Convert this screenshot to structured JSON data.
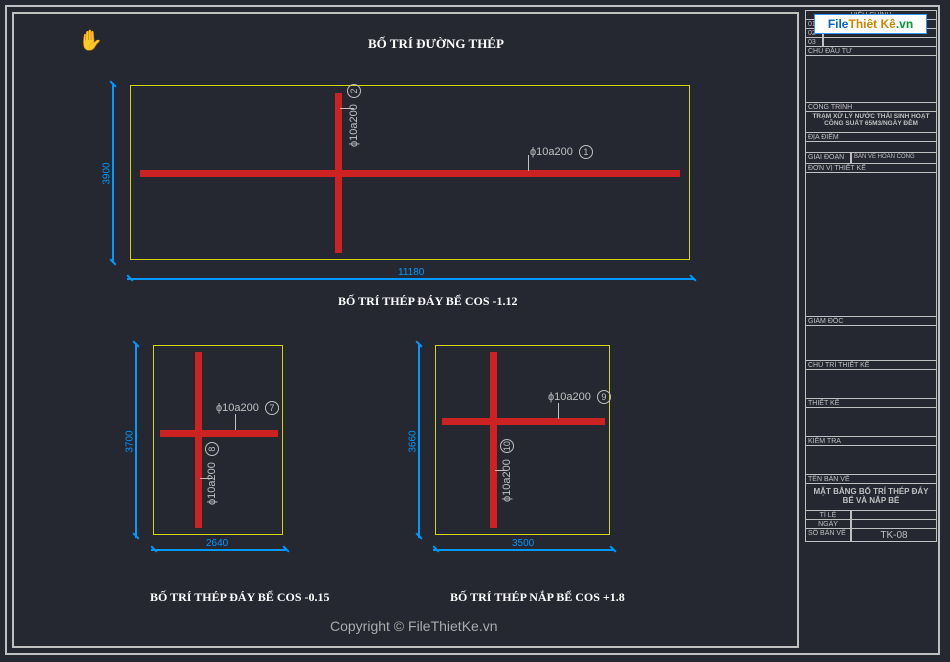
{
  "titles": {
    "main": "BỐ TRÍ ĐƯỜNG THÉP",
    "sub1": "BỐ TRÍ THÉP ĐÁY BỂ COS -1.12",
    "sub2": "BỐ TRÍ THÉP ĐÁY BỂ COS -0.15",
    "sub3": "BỐ TRÍ THÉP NẮP BỂ COS +1.8"
  },
  "dimensions": {
    "top_width": "11180",
    "top_height": "3900",
    "left_width": "2640",
    "left_height": "3700",
    "right_width": "3500",
    "right_height": "3660"
  },
  "rebar": {
    "label_1": "ϕ10a200",
    "tag_1": "1",
    "label_2": "ϕ10a200",
    "tag_2": "2",
    "label_7": "ϕ10a200",
    "tag_7": "7",
    "label_8": "ϕ10a200",
    "tag_8": "8",
    "label_9": "ϕ10a200",
    "tag_9": "9",
    "label_10": "ϕ10a200",
    "tag_10": "10"
  },
  "titleblock": {
    "hieu_chinh": "HIỆU CHỈNH",
    "r1": "01",
    "r2": "02",
    "r3": "03",
    "chu_dau_tu": "CHỦ ĐẦU TƯ",
    "cong_trinh": "CÔNG TRÌNH",
    "cong_trinh_val": "TRẠM XỬ LÝ NƯỚC THẢI SINH HOẠT CÔNG SUẤT 65M3/NGÀY ĐÊM",
    "dia_diem": "ĐỊA ĐIỂM",
    "giai_doan": "GIAI ĐOẠN",
    "ban_ve": "BẢN VẼ HOÀN CÔNG",
    "don_vi": "ĐƠN VỊ THIẾT KẾ",
    "giam_doc": "GIÁM ĐỐC",
    "chu_tri": "CHỦ TRÌ THIẾT KẾ",
    "thiet_ke": "THIẾT KẾ",
    "kiem_tra": "KIỂM TRA",
    "ten_ban_ve": "TÊN BẢN VẼ",
    "ten_ban_ve_val": "MẶT BẰNG BỐ TRÍ THÉP ĐÁY BỂ VÀ NẮP BỂ",
    "ti_le": "TỈ LỆ",
    "ngay": "NGÀY",
    "so_ban_ve": "SỐ BẢN VẼ",
    "so_ban_ve_val": "TK-08"
  },
  "watermark": "Copyright © FileThietKe.vn",
  "logo": {
    "file": "File",
    "tk": "Thiêt Kê",
    "vn": ".vn"
  },
  "cursor": "✋"
}
